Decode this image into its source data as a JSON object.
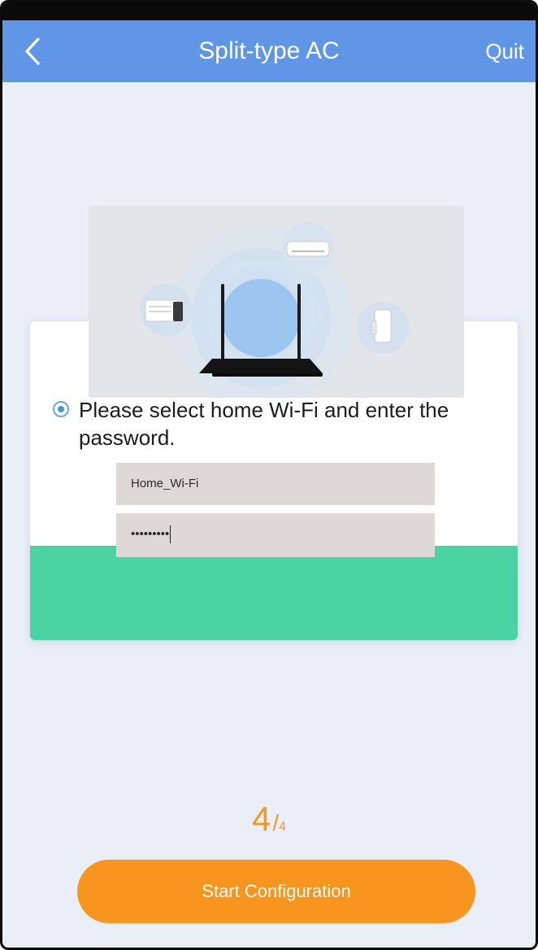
{
  "header": {
    "title": "Split-type AC",
    "back_icon": "chevron-left-icon",
    "quit_label": "Quit"
  },
  "colors": {
    "header_bg": "#5f97e6",
    "page_bg": "#eaeef7",
    "card_band": "#4bd3a3",
    "accent_orange": "#f7951e",
    "radio_blue": "#4a8ee4"
  },
  "illustration": {
    "icons": [
      "router-icon",
      "air-conditioner-icon",
      "window-ac-icon",
      "portable-ac-icon"
    ]
  },
  "form": {
    "instruction": "Please select home Wi-Fi and enter the password.",
    "ssid_value": "Home_Wi-Fi",
    "password_value": "•••••••••"
  },
  "step": {
    "current": "4",
    "separator": "/",
    "total": "4"
  },
  "actions": {
    "start_label": "Start Configuration"
  }
}
